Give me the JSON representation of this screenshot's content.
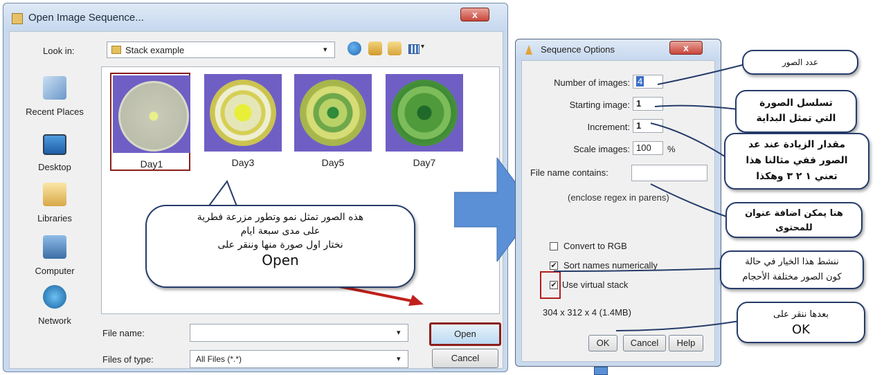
{
  "open_dialog": {
    "title": "Open Image Sequence...",
    "close_glyph": "x",
    "look_in_label": "Look in:",
    "look_in_value": "Stack example",
    "places": [
      "Recent Places",
      "Desktop",
      "Libraries",
      "Computer",
      "Network"
    ],
    "thumbnails": [
      "Day1",
      "Day3",
      "Day5",
      "Day7"
    ],
    "file_name_label": "File name:",
    "file_name_value": "",
    "files_of_type_label": "Files of type:",
    "files_of_type_value": "All Files (*.*)",
    "open_button": "Open",
    "cancel_button": "Cancel",
    "dropdown_glyph": "▾"
  },
  "sequence_dialog": {
    "title": "Sequence Options",
    "close_glyph": "x",
    "number_of_images_label": "Number of images:",
    "number_of_images_value": "4",
    "starting_image_label": "Starting image:",
    "starting_image_value": "1",
    "increment_label": "Increment:",
    "increment_value": "1",
    "scale_images_label": "Scale images:",
    "scale_images_value": "100",
    "scale_unit": "%",
    "file_name_contains_label": "File name contains:",
    "file_name_contains_value": "",
    "regex_hint": "(enclose regex in parens)",
    "convert_rgb_label": "Convert to RGB",
    "convert_rgb_checked": false,
    "sort_names_label": "Sort names numerically",
    "sort_names_checked": true,
    "virtual_stack_label": "Use virtual stack",
    "virtual_stack_checked": true,
    "memory_info": "304 x 312 x 4 (1.4MB)",
    "ok_button": "OK",
    "cancel_button": "Cancel",
    "help_button": "Help",
    "check_glyph": "✔"
  },
  "callouts": {
    "main_line1": "هذه الصور تمثل نمو وتطور مزرعة فطرية",
    "main_line2": "على مدى سبعة ايام",
    "main_line3": "نختار اول صورة منها وننقر على",
    "main_open": "Open",
    "number_of_images": "عدد الصور",
    "starting_image_line1": "تسلسل الصورة",
    "starting_image_line2": "التي تمثل البداية",
    "increment_line1": "مقدار الزيادة عند عد",
    "increment_line2": "الصور ففي مثالنا هذا",
    "increment_line3": "تعني ١ ٢ ٣ وهكذا",
    "file_name_line1": "هنا يمكن اضافة عنوان",
    "file_name_line2": "للمحتوى",
    "virtual_line1": "ننشط هذا الخيار في حالة",
    "virtual_line2": "كون الصور مختلفة الأحجام",
    "ok_line1": "بعدها ننقر على",
    "ok_line2": "OK"
  },
  "colors": {
    "highlight_border": "#8b1e1a",
    "callout_border": "#253c6a",
    "arrow_fill": "#5b8fd6",
    "pointer_arrow": "#c0201c"
  }
}
